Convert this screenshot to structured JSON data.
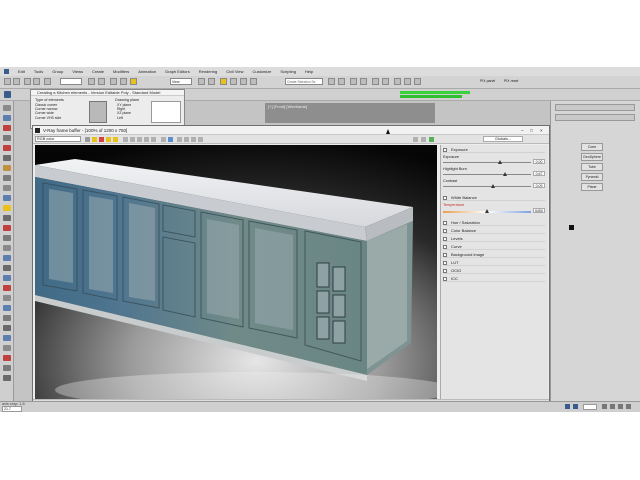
{
  "menu": [
    "Edit",
    "Tools",
    "Group",
    "Views",
    "Create",
    "Modifiers",
    "Animation",
    "Graph Editors",
    "Rendering",
    "Civil View",
    "Customize",
    "Scripting",
    "Help"
  ],
  "toolbar": {
    "view_dropdown": "View",
    "selection_set_placeholder": "Create Selection Se"
  },
  "vray_buttons": [
    "PIX panel",
    "PIX reset"
  ],
  "dialog": {
    "title": "Creating a Kitchen elements - Version Editable Poly - Standard Model",
    "group_label": "Type of elements",
    "options": [
      "Classic corner",
      "Corner narrow",
      "Corner wide",
      "Corner VHS side"
    ],
    "drawing_label": "Drawing plane",
    "drawing_options": [
      "XY plane",
      "Right",
      "XZ plane",
      "Left"
    ]
  },
  "viewport_label": "[+] [Front] [Wireframe]",
  "vfb": {
    "title": "V-Ray frame buffer - [100% of 1200 x 750]",
    "channel": "RGB color",
    "status": "Rendering image... done [00:00:07.8]"
  },
  "color_correction": {
    "header_button": "Globals...",
    "exposure": {
      "label": "Exposure",
      "rows": [
        {
          "label": "Exposure",
          "value": "0.00",
          "knob": 0.62
        },
        {
          "label": "Highlight Burn",
          "value": "0.67",
          "knob": 0.68
        },
        {
          "label": "Contrast",
          "value": "0.09",
          "knob": 0.54
        }
      ]
    },
    "white_balance": {
      "label": "White Balance",
      "temperature_label": "Temperature",
      "temperature_value": "6450",
      "knob": 0.48
    },
    "sections": [
      "Hue / Saturation",
      "Color Balance",
      "Levels",
      "Curve",
      "Background image",
      "LUT",
      "OCIO",
      "ICC"
    ]
  },
  "command_panel": {
    "buttons": [
      "Cone",
      "GeoSphere",
      "Tube",
      "Pyramid",
      "Plane"
    ]
  },
  "status": {
    "left_text": "axis crop: 1.8",
    "coord_field": "21.7"
  },
  "colors": {
    "accent_yellow": "#e8c21a",
    "selection_green": "#3ad23a",
    "cabinet": "#6f8a8a",
    "worktop": "#e8eaec"
  }
}
